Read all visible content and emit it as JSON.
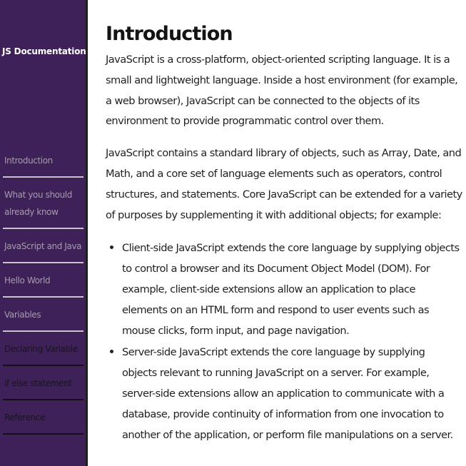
{
  "sidebar": {
    "title": "JS Documentation",
    "items": [
      {
        "label": "Introduction"
      },
      {
        "label": "What you should already know"
      },
      {
        "label": "JavaScript and Java"
      },
      {
        "label": "Hello World"
      },
      {
        "label": "Variables"
      },
      {
        "label": "Declaring Variable"
      },
      {
        "label": "if else statement"
      },
      {
        "label": "Reference"
      }
    ]
  },
  "main": {
    "title": "Introduction",
    "paragraphs": [
      "JavaScript is a cross-platform, object-oriented scripting language. It is a small and lightweight language. Inside a host environment (for example, a web browser), JavaScript can be connected to the objects of its environment to provide programmatic control over them.",
      "JavaScript contains a standard library of objects, such as Array, Date, and Math, and a core set of language elements such as operators, control structures, and statements. Core JavaScript can be extended for a variety of purposes by supplementing it with additional objects; for example:"
    ],
    "bullets": [
      "Client-side JavaScript extends the core language by supplying objects to control a browser and its Document Object Model (DOM). For example, client-side extensions allow an application to place elements on an HTML form and respond to user events such as mouse clicks, form input, and page navigation.",
      "Server-side JavaScript extends the core language by supplying objects relevant to running JavaScript on a server. For example, server-side extensions allow an application to communicate with a database, provide continuity of information from one invocation to another of the application, or perform file manipulations on a server."
    ]
  },
  "colors": {
    "sidebar_bg": "#3f2159",
    "nav_text_light": "#a59bae",
    "nav_text_dark": "#1a1320"
  }
}
